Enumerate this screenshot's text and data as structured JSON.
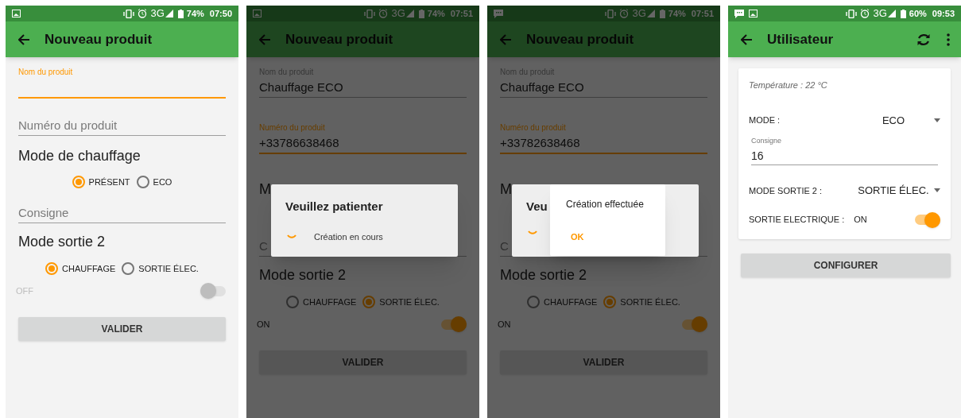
{
  "screens": [
    {
      "kind": "product_form",
      "dimmed": false,
      "status_bar": {
        "notifications": [
          {
            "kind": "image"
          }
        ],
        "network": "3G",
        "battery": "74%",
        "time": "07:50"
      },
      "app_bar": {
        "title": "Nouveau produit"
      },
      "name_field": {
        "label": "Nom du produit",
        "focused": true
      },
      "number_field": {
        "placeholder": "Numéro du produit",
        "focused": false
      },
      "heating_heading": "Mode de chauffage",
      "heating_options": [
        {
          "label": "PRÉSENT",
          "selected": true
        },
        {
          "label": "ECO",
          "selected": false
        }
      ],
      "setpoint_field": {
        "placeholder": "Consigne",
        "focused": false
      },
      "output_heading": "Mode sortie 2",
      "output_options": [
        {
          "label": "CHAUFFAGE",
          "selected": true
        },
        {
          "label": "SORTIE ÉLEC.",
          "selected": false
        }
      ],
      "switch": {
        "label": "OFF",
        "on": false
      },
      "button": "VALIDER"
    },
    {
      "kind": "product_form",
      "dimmed": true,
      "status_bar": {
        "notifications": [
          {
            "kind": "image"
          }
        ],
        "network": "3G",
        "battery": "74%",
        "time": "07:51"
      },
      "app_bar": {
        "title": "Nouveau produit"
      },
      "name_field": {
        "label": "Nom du produit",
        "value": "Chauffage ECO",
        "focused": false
      },
      "number_field": {
        "label": "Numéro du produit",
        "value": "+33786638468",
        "focused": true
      },
      "heating_heading": "M",
      "setpoint_field": {
        "placeholder": "C",
        "focused": false
      },
      "output_heading": "Mode sortie 2",
      "output_options": [
        {
          "label": "CHAUFFAGE",
          "selected": false
        },
        {
          "label": "SORTIE ÉLEC.",
          "selected": true
        }
      ],
      "switch": {
        "label": "ON",
        "on": true
      },
      "button": "VALIDER",
      "dialogs": [
        {
          "kind": "progress",
          "title": "Veuillez patienter",
          "message": "Création en cours"
        }
      ]
    },
    {
      "kind": "product_form",
      "dimmed": true,
      "status_bar": {
        "notifications": [
          {
            "kind": "message"
          }
        ],
        "network": "3G",
        "battery": "74%",
        "time": "07:51"
      },
      "app_bar": {
        "title": "Nouveau produit"
      },
      "name_field": {
        "label": "Nom du produit",
        "value": "Chauffage ECO",
        "focused": false
      },
      "number_field": {
        "label": "Numéro du produit",
        "value": "+33782638468",
        "focused": true
      },
      "heating_heading": "M",
      "setpoint_field": {
        "placeholder": "C",
        "focused": false
      },
      "output_heading": "Mode sortie 2",
      "output_options": [
        {
          "label": "CHAUFFAGE",
          "selected": false
        },
        {
          "label": "SORTIE ÉLEC.",
          "selected": true
        }
      ],
      "switch": {
        "label": "ON",
        "on": true
      },
      "button": "VALIDER",
      "dialogs": [
        {
          "kind": "progress",
          "title": "Veu"
        },
        {
          "kind": "alert",
          "message": "Création effectuée",
          "button": "OK"
        }
      ]
    },
    {
      "kind": "user_settings",
      "dimmed": false,
      "status_bar": {
        "notifications": [
          {
            "kind": "message"
          },
          {
            "kind": "image"
          }
        ],
        "network": "3G",
        "battery": "60%",
        "time": "09:53"
      },
      "app_bar": {
        "title": "Utilisateur",
        "actions": [
          {
            "kind": "refresh"
          },
          {
            "kind": "more"
          }
        ]
      },
      "temperature": "Température : 22 °C",
      "mode": {
        "label": "MODE :",
        "value": "ECO"
      },
      "setpoint_field": {
        "label": "Consigne",
        "value": "16"
      },
      "output_mode": {
        "label": "MODE SORTIE 2 :",
        "value": "SORTIE ÉLEC."
      },
      "switch": {
        "label": "SORTIE ELECTRIQUE :",
        "state_text": "ON",
        "on": true
      },
      "button": "CONFIGURER"
    }
  ]
}
